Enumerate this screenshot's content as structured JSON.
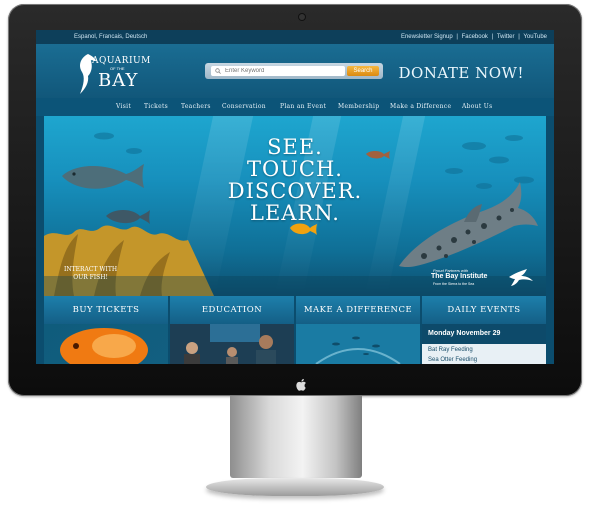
{
  "topbar": {
    "languages": "Espanol, Francais, Deutsch",
    "links": [
      "Enewsletter Signup",
      "Facebook",
      "Twitter",
      "YouTube"
    ],
    "separator": "|"
  },
  "header": {
    "logo_top": "AQUARIUM",
    "logo_mid": "OF THE",
    "logo_bottom": "BAY",
    "search_placeholder": "Enter Keyword",
    "search_button": "Search",
    "donate": "DONATE NOW!"
  },
  "nav": {
    "items": [
      "Visit",
      "Tickets",
      "Teachers",
      "Conservation",
      "Plan an Event",
      "Membership",
      "Make a Difference",
      "About Us"
    ]
  },
  "hero": {
    "lines": [
      "SEE.",
      "TOUCH.",
      "DISCOVER.",
      "LEARN."
    ],
    "interact_line1": "INTERACT WITH",
    "interact_line2": "OUR FISH!",
    "partner_small": "Proud Partners with",
    "partner_name": "The Bay Institute",
    "partner_tag": "From the Sierra to the Sea"
  },
  "tabs": [
    "BUY TICKETS",
    "EDUCATION",
    "MAKE A DIFFERENCE",
    "DAILY EVENTS"
  ],
  "events": {
    "date": "Monday November 29",
    "items": [
      "Bat Ray Feeding",
      "Sea Otter Feeding"
    ]
  },
  "colors": {
    "accent": "#1a7eab",
    "search_button": "#e49a1e",
    "dark_bar": "#0d3f5a"
  },
  "icons": [
    "search-icon",
    "fish-logo-icon",
    "bird-icon",
    "apple-icon",
    "shark-icon"
  ]
}
